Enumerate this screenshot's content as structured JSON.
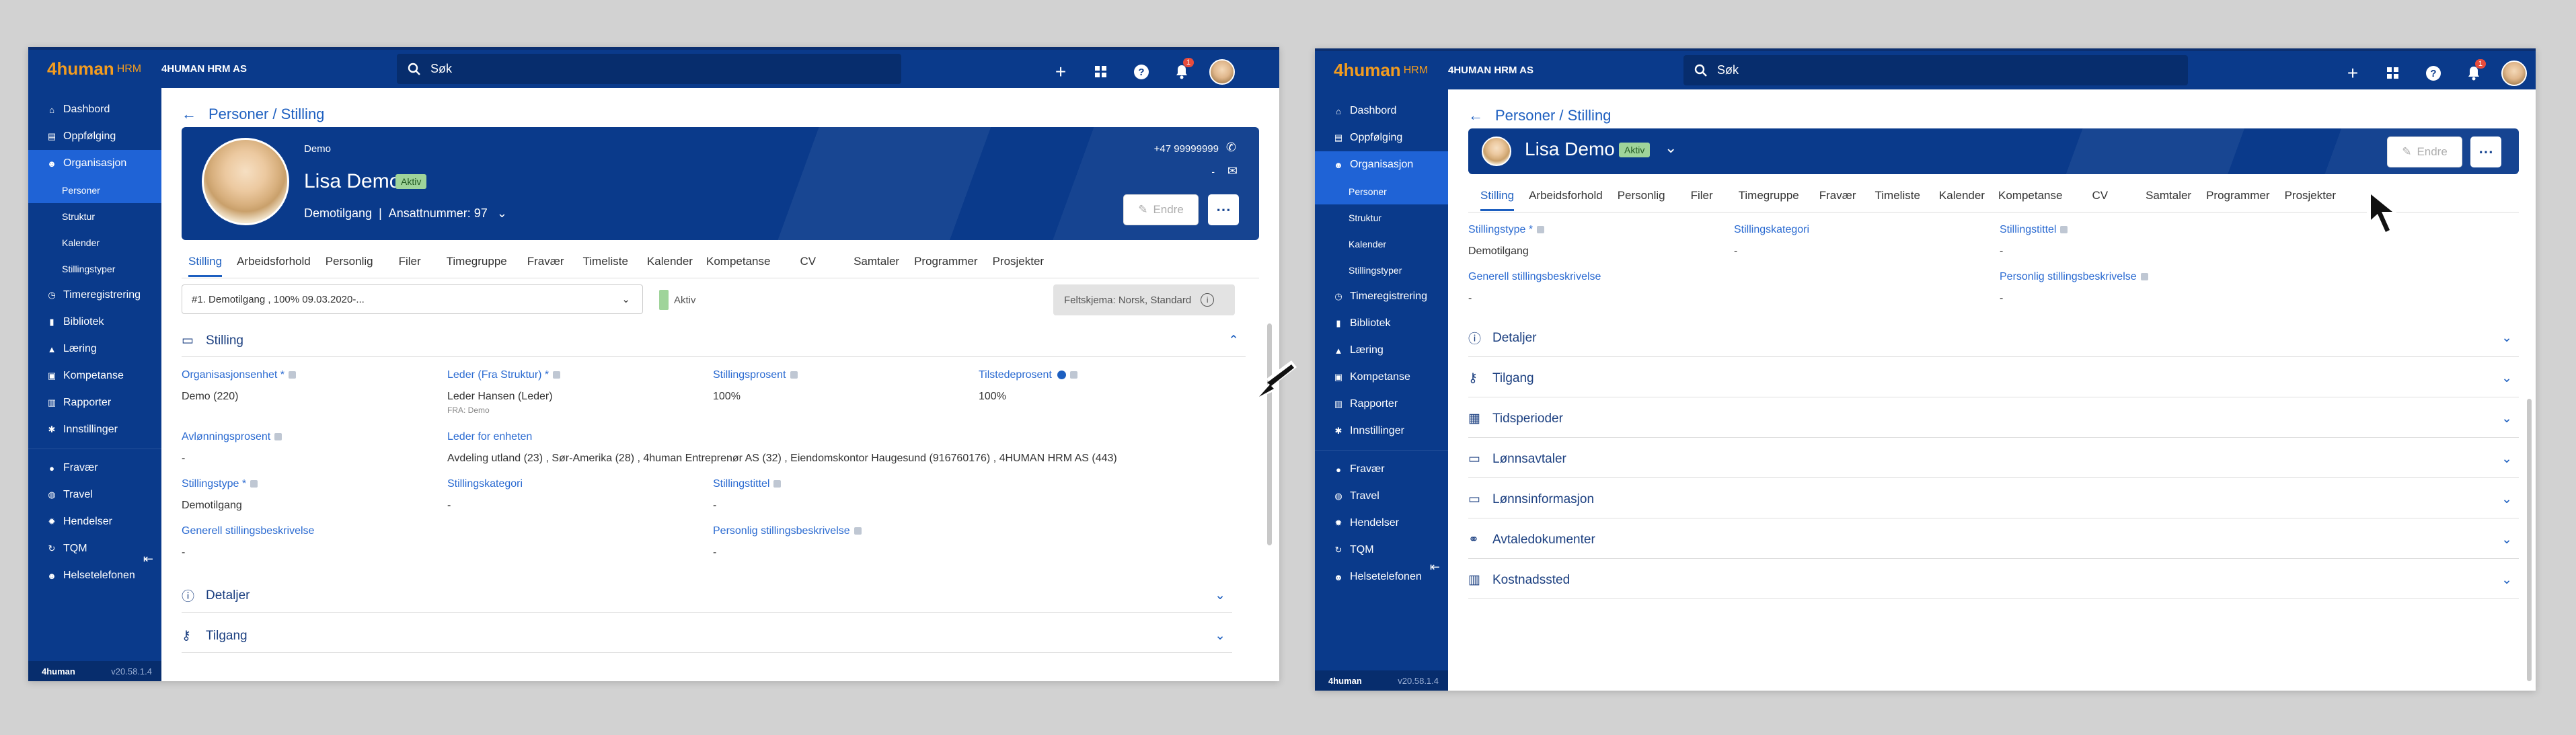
{
  "app": {
    "logo_primary": "4human",
    "logo_suffix": "HRM",
    "company": "4HUMAN HRM AS",
    "search_placeholder": "Søk",
    "notification_count": "1",
    "version": "v20.58.1.4",
    "footer_logo": "4human"
  },
  "sidebar": {
    "items": [
      {
        "label": "Dashbord",
        "icon": "home-icon"
      },
      {
        "label": "Oppfølging",
        "icon": "clipboard-icon"
      },
      {
        "label": "Organisasjon",
        "icon": "people-icon"
      }
    ],
    "sub_items": [
      "Personer",
      "Struktur",
      "Kalender",
      "Stillingstyper"
    ],
    "items2": [
      {
        "label": "Timeregistrering",
        "icon": "clock-icon"
      },
      {
        "label": "Bibliotek",
        "icon": "book-icon"
      },
      {
        "label": "Læring",
        "icon": "graduation-icon"
      },
      {
        "label": "Kompetanse",
        "icon": "certificate-icon"
      },
      {
        "label": "Rapporter",
        "icon": "chart-icon"
      },
      {
        "label": "Innstillinger",
        "icon": "gear-icon"
      }
    ],
    "items3": [
      {
        "label": "Fravær",
        "icon": "person-icon"
      },
      {
        "label": "Travel",
        "icon": "globe-icon"
      },
      {
        "label": "Hendelser",
        "icon": "cog-icon"
      },
      {
        "label": "TQM",
        "icon": "cycle-icon"
      },
      {
        "label": "Helsetelefonen",
        "icon": "people-icon"
      }
    ]
  },
  "breadcrumb": "Personer / Stilling",
  "person": {
    "org": "Demo",
    "name": "Lisa Demo",
    "status": "Aktiv",
    "position": "Demotilgang",
    "employee_no": "Ansattnummer: 97",
    "phone": "+47 99999999",
    "dash": "-"
  },
  "header_buttons": {
    "edit": "Endre"
  },
  "tabs": [
    "Stilling",
    "Arbeidsforhold",
    "Personlig",
    "Filer",
    "Timegruppe",
    "Fravær",
    "Timeliste",
    "Kalender",
    "Kompetanse",
    "CV",
    "Samtaler",
    "Programmer",
    "Prosjekter"
  ],
  "left_panel": {
    "select_value": "#1. Demotilgang , 100% 09.03.2020-...",
    "active_label": "Aktiv",
    "schema": "Feltskjema: Norsk, Standard",
    "section_title": "Stilling",
    "fields": {
      "org_unit_label": "Organisasjonsenhet *",
      "org_unit_value": "Demo (220)",
      "leader_label": "Leder (Fra Struktur) *",
      "leader_value": "Leder Hansen (Leder)",
      "leader_from": "FRA: Demo",
      "percent_label": "Stillingsprosent",
      "percent_value": "100%",
      "presence_label": "Tilstedeprosent",
      "presence_value": "100%",
      "pay_percent_label": "Avlønningsprosent",
      "pay_percent_value": "-",
      "leader_for_label": "Leder for enheten",
      "leader_for_value": "Avdeling utland (23) , Sør-Amerika (28) , 4human Entreprenør AS (32) , Eiendomskontor Haugesund (916760176) , 4HUMAN HRM AS (443)",
      "type_label": "Stillingstype *",
      "type_value": "Demotilgang",
      "category_label": "Stillingskategori",
      "category_value": "-",
      "title_label": "Stillingstittel",
      "title_value": "-",
      "general_desc_label": "Generell stillingsbeskrivelse",
      "general_desc_value": "-",
      "personal_desc_label": "Personlig stillingsbeskrivelse",
      "personal_desc_value": "-"
    },
    "accordions": [
      "Detaljer",
      "Tilgang"
    ]
  },
  "right_panel": {
    "fields": {
      "type_label": "Stillingstype *",
      "type_value": "Demotilgang",
      "category_label": "Stillingskategori",
      "category_value": "-",
      "title_label": "Stillingstittel",
      "title_value": "-",
      "general_desc_label": "Generell stillingsbeskrivelse",
      "general_desc_value": "-",
      "personal_desc_label": "Personlig stillingsbeskrivelse",
      "personal_desc_value": "-"
    },
    "accordions": [
      "Detaljer",
      "Tilgang",
      "Tidsperioder",
      "Lønnsavtaler",
      "Lønnsinformasjon",
      "Avtaledokumenter",
      "Kostnadssted"
    ]
  },
  "colors": {
    "brand": "#0a3a8b",
    "accent": "#1d5fc0",
    "active": "#1f63d6",
    "chip": "#9fd49a"
  }
}
